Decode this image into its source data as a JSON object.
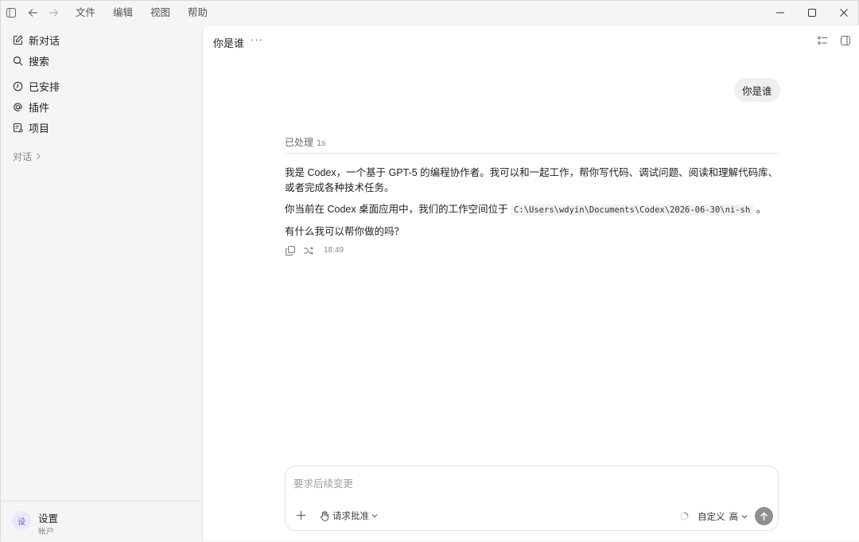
{
  "menu": {
    "items": [
      "文件",
      "编辑",
      "视图",
      "帮助"
    ]
  },
  "sidebar": {
    "items": [
      {
        "label": "新对话",
        "icon": "edit-icon"
      },
      {
        "label": "搜索",
        "icon": "search-icon"
      },
      {
        "label": "已安排",
        "icon": "clock-icon"
      },
      {
        "label": "插件",
        "icon": "at-icon"
      },
      {
        "label": "项目",
        "icon": "project-icon"
      }
    ],
    "section_label": "对话",
    "footer": {
      "avatar_text": "设",
      "name": "设置",
      "sub": "帐户"
    }
  },
  "conversation": {
    "title": "你是谁",
    "user_message": "你是谁",
    "processed_label": "已处理",
    "processed_duration": "1s",
    "reply": {
      "p1": "我是 Codex，一个基于 GPT-5 的编程协作者。我可以和一起工作，帮你写代码、调试问题、阅读和理解代码库、或者完成各种技术任务。",
      "p2_prefix": "你当前在 Codex 桌面应用中，我们的工作空间位于",
      "p2_path": "C:\\Users\\wdyin\\Documents\\Codex\\2026-06-30\\ni-sh",
      "p2_suffix": "。",
      "p3": "有什么我可以帮你做的吗？"
    },
    "time": "18:49"
  },
  "composer": {
    "placeholder": "要求后续变更",
    "approval_label": "请求批准",
    "mode_label": "自定义",
    "mode_level": "高"
  },
  "colors": {
    "send_button": "#8f8f8f",
    "user_bubble": "#efefef",
    "avatar_bg": "#ece8fb"
  }
}
